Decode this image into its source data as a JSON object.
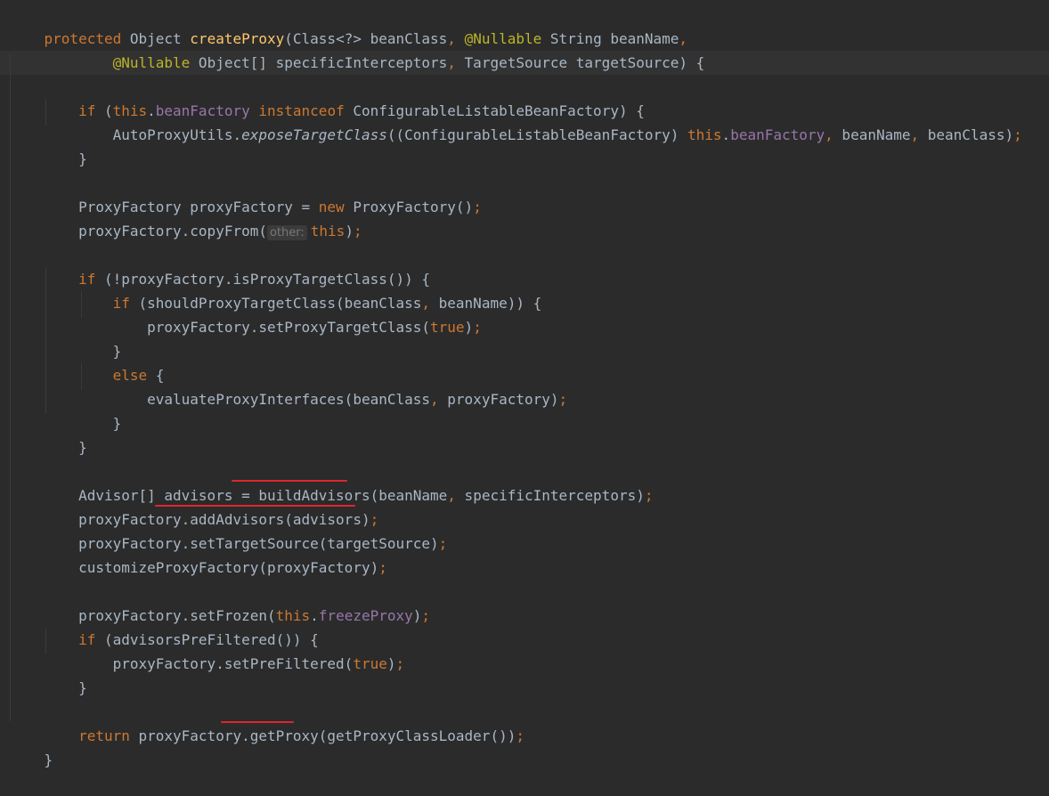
{
  "editor": {
    "language": "Java",
    "colors": {
      "background": "#2b2b2b",
      "text": "#a9b7c6",
      "keyword": "#cc7832",
      "method_declaration": "#ffc66d",
      "annotation": "#bbb529",
      "field": "#9876aa",
      "inlay_hint": "#787878",
      "annotation_underline": "#e0262d"
    },
    "inlay_hint": "other:",
    "lines": [
      "protected Object createProxy(Class<?> beanClass, @Nullable String beanName,",
      "        @Nullable Object[] specificInterceptors, TargetSource targetSource) {",
      "",
      "    if (this.beanFactory instanceof ConfigurableListableBeanFactory) {",
      "        AutoProxyUtils.exposeTargetClass((ConfigurableListableBeanFactory) this.beanFactory, beanName, beanClass);",
      "    }",
      "",
      "    ProxyFactory proxyFactory = new ProxyFactory();",
      "    proxyFactory.copyFrom(this);",
      "",
      "    if (!proxyFactory.isProxyTargetClass()) {",
      "        if (shouldProxyTargetClass(beanClass, beanName)) {",
      "            proxyFactory.setProxyTargetClass(true);",
      "        }",
      "        else {",
      "            evaluateProxyInterfaces(beanClass, proxyFactory);",
      "        }",
      "    }",
      "",
      "    Advisor[] advisors = buildAdvisors(beanName, specificInterceptors);",
      "    proxyFactory.addAdvisors(advisors);",
      "    proxyFactory.setTargetSource(targetSource);",
      "    customizeProxyFactory(proxyFactory);",
      "",
      "    proxyFactory.setFrozen(this.freezeProxy);",
      "    if (advisorsPreFiltered()) {",
      "        proxyFactory.setPreFiltered(true);",
      "    }",
      "",
      "    return proxyFactory.getProxy(getProxyClassLoader());",
      "}"
    ],
    "underlined_calls": [
      "buildAdvisors",
      "addAdvisors(advisors)",
      "getProxy"
    ]
  }
}
